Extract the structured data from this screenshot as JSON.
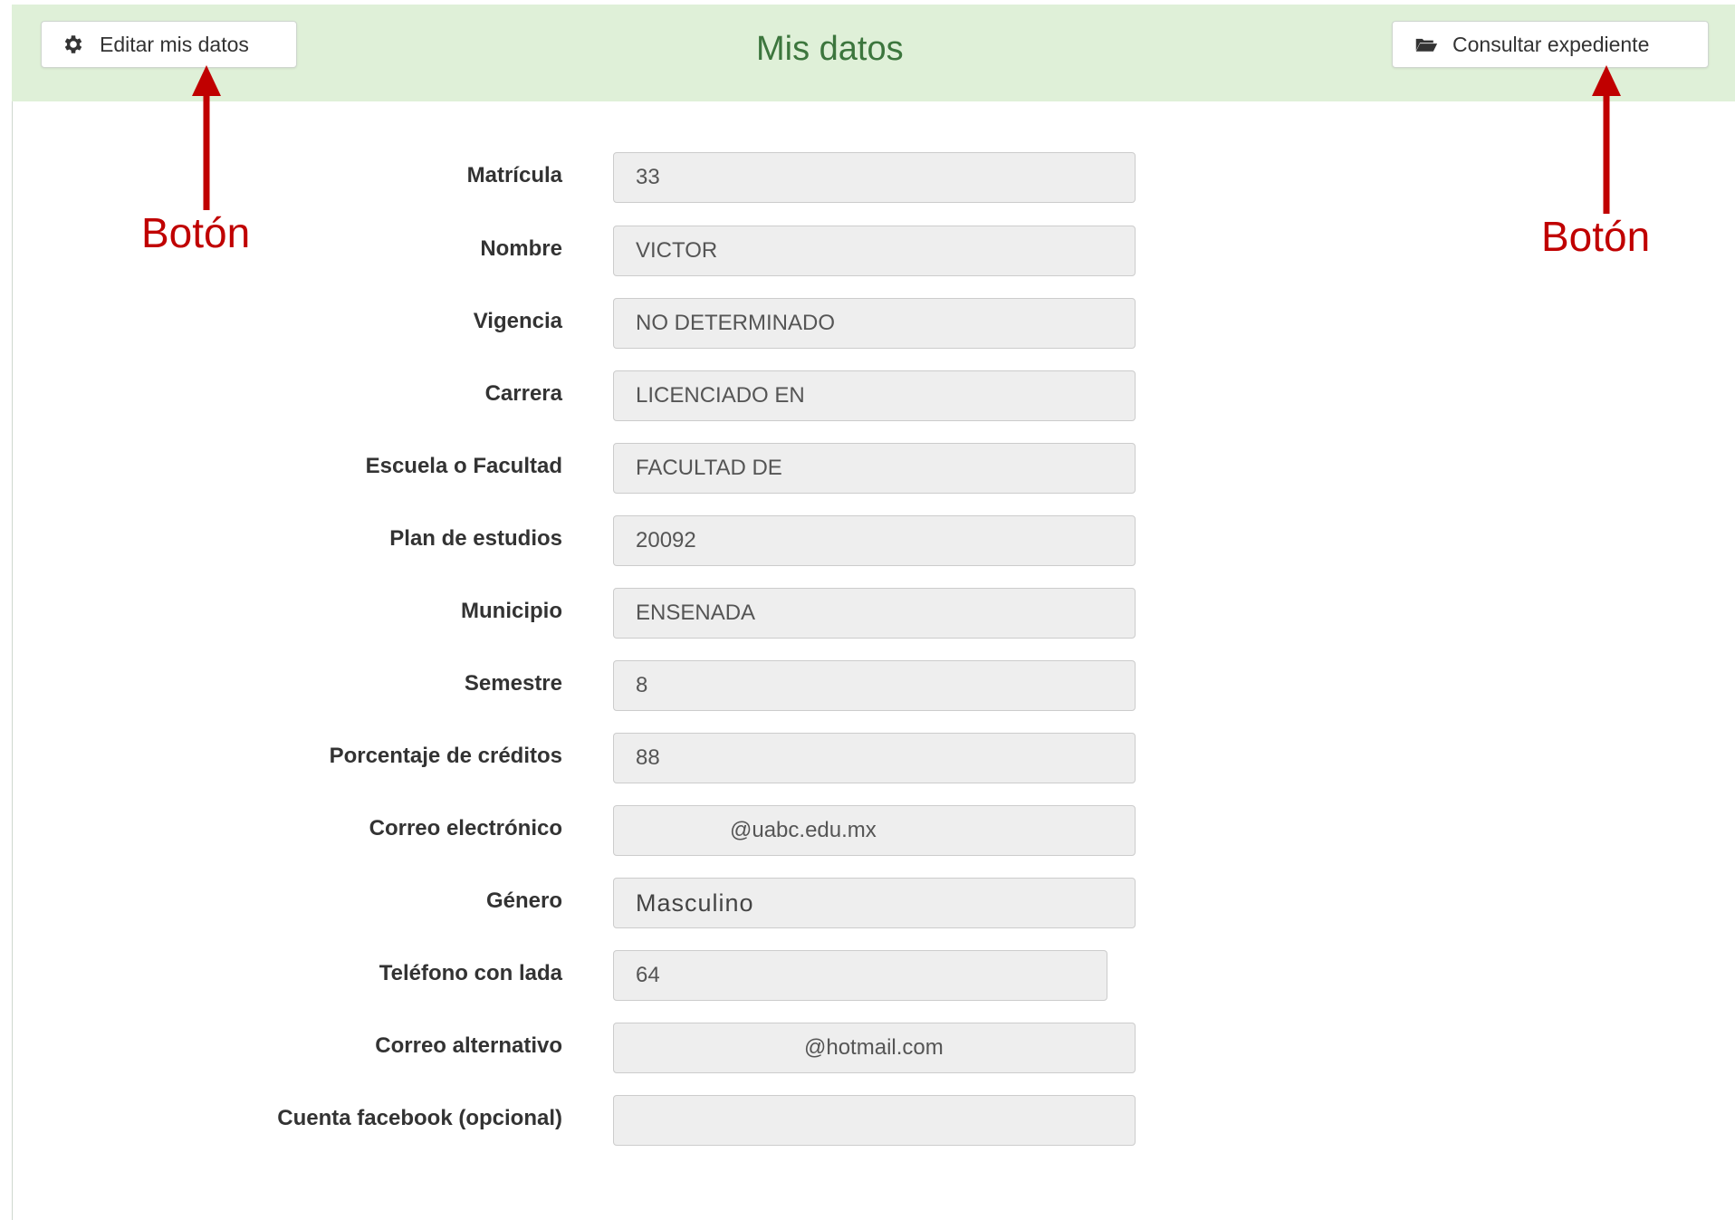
{
  "header": {
    "title": "Mis datos",
    "edit_button": {
      "label": "Editar mis datos",
      "icon": "gear-icon"
    },
    "record_button": {
      "label": "Consultar expediente",
      "icon": "folder-open-icon"
    }
  },
  "annotations": {
    "left": "Botón",
    "right": "Botón",
    "color": "#c00000"
  },
  "form": {
    "fields": [
      {
        "label": "Matrícula",
        "value": "33"
      },
      {
        "label": "Nombre",
        "value": "VICTOR"
      },
      {
        "label": "Vigencia",
        "value": "NO DETERMINADO"
      },
      {
        "label": "Carrera",
        "value": "LICENCIADO EN"
      },
      {
        "label": "Escuela o Facultad",
        "value": "FACULTAD DE"
      },
      {
        "label": "Plan de estudios",
        "value": "20092"
      },
      {
        "label": "Municipio",
        "value": "ENSENADA"
      },
      {
        "label": "Semestre",
        "value": "8"
      },
      {
        "label": "Porcentaje de créditos",
        "value": "88"
      },
      {
        "label": "Correo electrónico",
        "value": "@uabc.edu.mx"
      },
      {
        "label": "Género",
        "value": "Masculino"
      },
      {
        "label": "Teléfono con lada",
        "value": "64"
      },
      {
        "label": "Correo alternativo",
        "value": "@hotmail.com"
      },
      {
        "label": "Cuenta facebook (opcional)",
        "value": ""
      }
    ]
  },
  "colors": {
    "header_bg": "#dff0d8",
    "title": "#3c763d",
    "input_bg": "#eeeeee"
  }
}
